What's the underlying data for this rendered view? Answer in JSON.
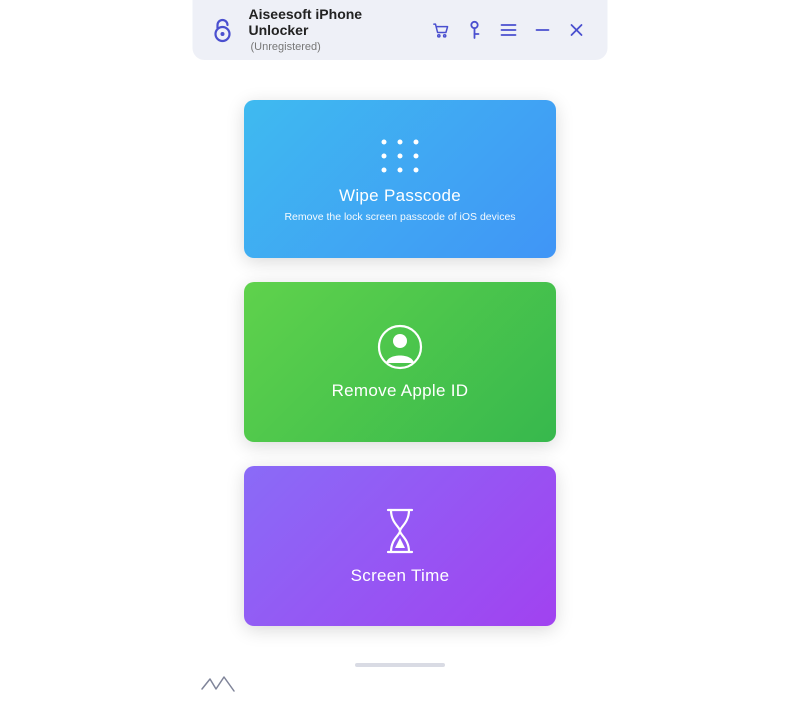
{
  "header": {
    "title": "Aiseesoft iPhone Unlocker",
    "subtitle": "(Unregistered)"
  },
  "cards": {
    "wipe": {
      "title": "Wipe Passcode",
      "desc": "Remove the lock screen passcode of iOS devices"
    },
    "appleid": {
      "title": "Remove Apple ID"
    },
    "screentime": {
      "title": "Screen Time"
    }
  }
}
